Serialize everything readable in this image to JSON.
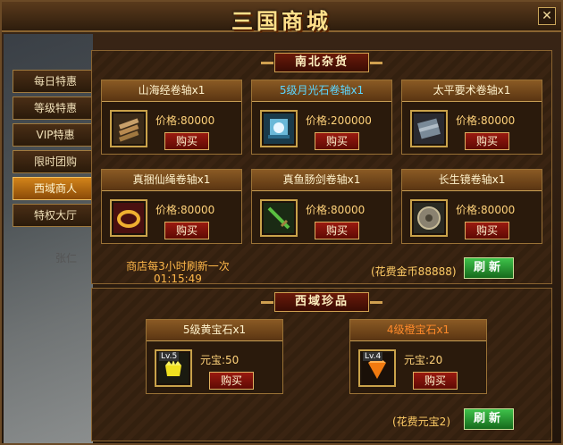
{
  "window": {
    "title": "三国商城",
    "close_label": "✕"
  },
  "backdrop": {
    "label": "张仁"
  },
  "nav": {
    "items": [
      {
        "label": "每日特惠"
      },
      {
        "label": "等级特惠"
      },
      {
        "label": "VIP特惠"
      },
      {
        "label": "限时团购"
      },
      {
        "label": "西域商人",
        "active": true
      },
      {
        "label": "特权大厅"
      }
    ]
  },
  "top_section": {
    "title": "南北杂货",
    "items": [
      {
        "name": "山海经卷轴x1",
        "price": "价格:80000",
        "buy": "购买",
        "icon": "scroll-bundle-icon",
        "name_color": "normal"
      },
      {
        "name": "5级月光石卷轴x1",
        "price": "价格:200000",
        "buy": "购买",
        "icon": "moonstone-scroll-icon",
        "name_color": "blue"
      },
      {
        "name": "太平要术卷轴x1",
        "price": "价格:80000",
        "buy": "购买",
        "icon": "bound-scroll-icon",
        "name_color": "normal"
      },
      {
        "name": "真捆仙绳卷轴x1",
        "price": "价格:80000",
        "buy": "购买",
        "icon": "golden-rope-icon",
        "name_color": "normal"
      },
      {
        "name": "真鱼肠剑卷轴x1",
        "price": "价格:80000",
        "buy": "购买",
        "icon": "green-sword-icon",
        "name_color": "normal"
      },
      {
        "name": "长生镜卷轴x1",
        "price": "价格:80000",
        "buy": "购买",
        "icon": "bronze-mirror-icon",
        "name_color": "normal"
      }
    ],
    "refresh_note": "商店每3小时刷新一次",
    "timer": "01:15:49",
    "cost": "(花费金币88888)",
    "refresh_label": "刷新"
  },
  "bottom_section": {
    "title": "西域珍品",
    "items": [
      {
        "name": "5级黄宝石x1",
        "level": "Lv.5",
        "price": "元宝:50",
        "buy": "购买",
        "icon": "yellow-gem-icon",
        "name_color": "normal"
      },
      {
        "name": "4级橙宝石x1",
        "level": "Lv.4",
        "price": "元宝:20",
        "buy": "购买",
        "icon": "orange-gem-icon",
        "name_color": "orange"
      }
    ],
    "cost": "(花费元宝2)",
    "refresh_label": "刷新"
  }
}
